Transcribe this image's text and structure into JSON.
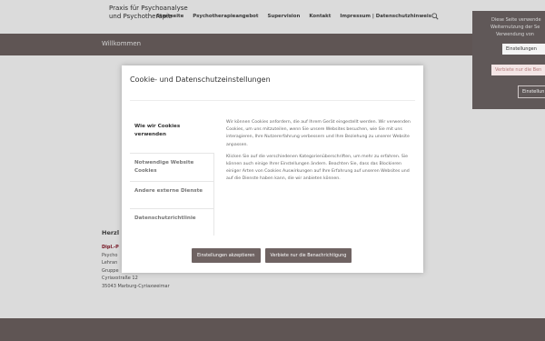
{
  "header": {
    "logo_text": "Praxis für Psychoanalyse und Psychotherapie",
    "nav": [
      "Startseite",
      "Psychotherapieangebot",
      "Supervision",
      "Kontakt",
      "Impressum | Datenschutzhinweis"
    ],
    "icon": "search-icon"
  },
  "title_bar": {
    "title": "Willkommen"
  },
  "content": {
    "heading": "Herzl",
    "name": "Dipl.-P",
    "lines": [
      "Psycho",
      "Lehran",
      "Gruppe",
      "Cyriaxstraße 12",
      "35043 Marburg-Cyriaxweimar"
    ]
  },
  "cookie_bar": {
    "text_lines": [
      "Diese Seite verwende",
      "Weiternutzung der Se",
      "Verwendung von"
    ],
    "settings_button": "Einstellungen",
    "deny_button": "Verbiete nur die Ben",
    "outline_button": "Einstellun"
  },
  "modal": {
    "title": "Cookie- und Datenschutzeinstellungen",
    "tabs": [
      "Wie wir Cookies verwenden",
      "Notwendige Website Cookies",
      "Andere externe Dienste",
      "Datenschutzrichtlinie"
    ],
    "body_p1": "Wir können Cookies anfordern, die auf Ihrem Gerät eingestellt werden. Wir verwenden Cookies, um uns mitzuteilen, wenn Sie unsere Websites besuchen, wie Sie mit uns interagieren, Ihre Nutzererfahrung verbessern und Ihre Beziehung zu unserer Website anpassen.",
    "body_p2": "Klicken Sie auf die verschiedenen Kategorienüberschriften, um mehr zu erfahren. Sie können auch einige Ihrer Einstellungen ändern. Beachten Sie, dass das Blockieren einiger Arten von Cookies Auswirkungen auf Ihre Erfahrung auf unseren Websites und auf die Dienste haben kann, die wir anbieten können.",
    "accept_button": "Einstellungen akzeptieren",
    "deny_button": "Verbiete nur die Benachrichtigung"
  },
  "colors": {
    "brand": "#6f6362",
    "link": "#8a1a2a"
  }
}
